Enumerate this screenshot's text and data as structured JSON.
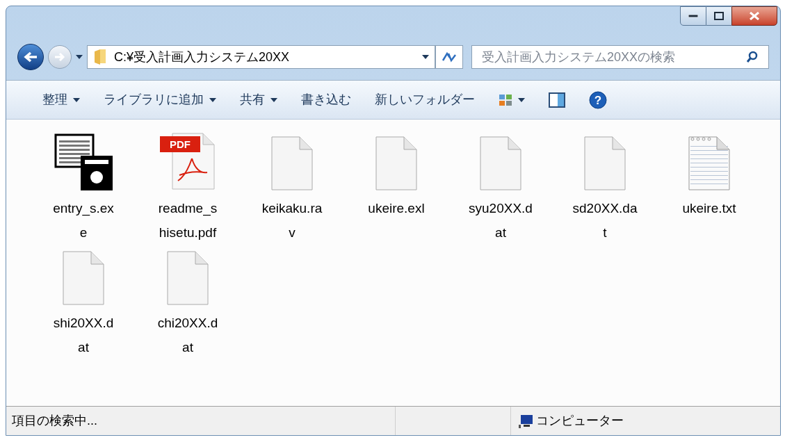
{
  "address_bar": {
    "path": "C:¥受入計画入力システム20XX"
  },
  "search": {
    "placeholder": "受入計画入力システム20XXの検索"
  },
  "toolbar": [
    {
      "kind": "menu",
      "label": "整理",
      "dropdown": true
    },
    {
      "kind": "menu",
      "label": "ライブラリに追加",
      "dropdown": true
    },
    {
      "kind": "menu",
      "label": "共有",
      "dropdown": true
    },
    {
      "kind": "menu",
      "label": "書き込む",
      "dropdown": false
    },
    {
      "kind": "menu",
      "label": "新しいフォルダー",
      "dropdown": false
    },
    {
      "kind": "views",
      "dropdown": true
    },
    {
      "kind": "pane",
      "dropdown": false
    },
    {
      "kind": "help",
      "dropdown": false,
      "glyph": "?"
    }
  ],
  "files": [
    {
      "kind": "exe",
      "name_lines": [
        "entry_s.ex",
        "e"
      ]
    },
    {
      "kind": "pdf",
      "badge": "PDF",
      "name_lines": [
        "readme_s",
        "hisetu.pdf"
      ]
    },
    {
      "kind": "blank",
      "name_lines": [
        "keikaku.ra",
        "v"
      ]
    },
    {
      "kind": "blank",
      "name_lines": [
        "ukeire.exl"
      ]
    },
    {
      "kind": "blank",
      "name_lines": [
        "syu20XX.d",
        "at"
      ]
    },
    {
      "kind": "blank",
      "name_lines": [
        "sd20XX.da",
        "t"
      ]
    },
    {
      "kind": "text",
      "name_lines": [
        "ukeire.txt"
      ]
    },
    {
      "kind": "blank",
      "name_lines": [
        "shi20XX.d",
        "at"
      ]
    },
    {
      "kind": "blank",
      "name_lines": [
        "chi20XX.d",
        "at"
      ]
    }
  ],
  "status_bar": {
    "message": "項目の検索中...",
    "location": "コンピューター"
  }
}
